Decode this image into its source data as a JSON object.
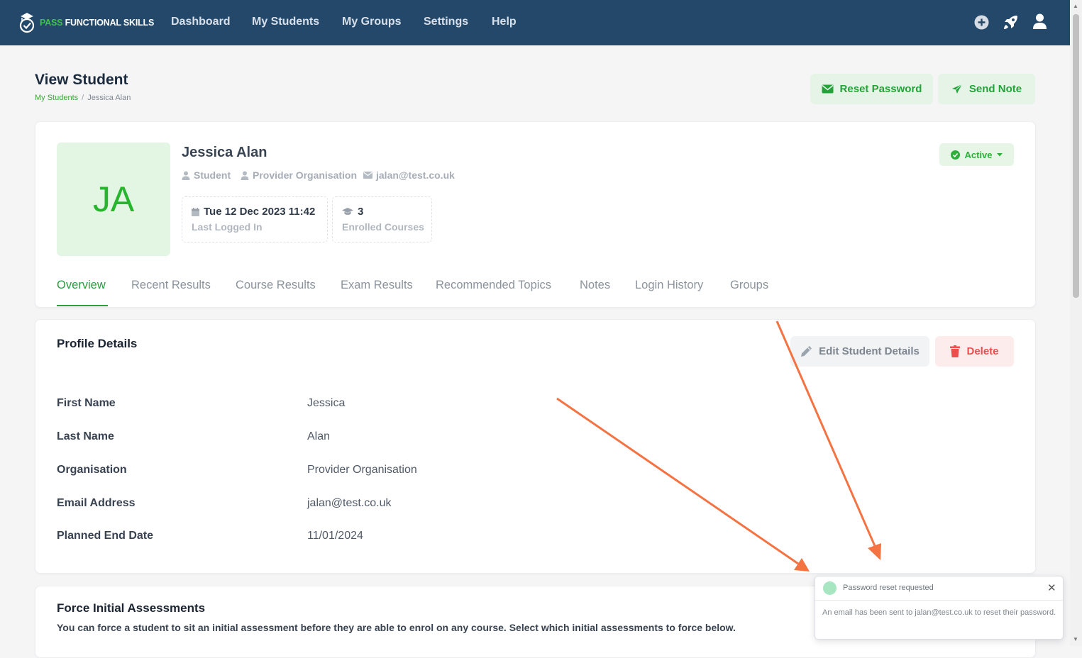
{
  "navbar": {
    "logo_pass": "PASS",
    "logo_rest": "FUNCTIONAL SKILLS",
    "items": [
      {
        "label": "Dashboard"
      },
      {
        "label": "My Students"
      },
      {
        "label": "My Groups"
      },
      {
        "label": "Settings"
      },
      {
        "label": "Help"
      }
    ],
    "icons": [
      "plus-circle-icon",
      "rocket-icon",
      "user-icon"
    ]
  },
  "page": {
    "title": "View Student",
    "breadcrumb": {
      "parent": "My Students",
      "separator": "/",
      "current": "Jessica Alan"
    },
    "reset_password_label": "Reset Password",
    "send_note_label": "Send Note"
  },
  "student": {
    "initials": "JA",
    "name": "Jessica Alan",
    "role": "Student",
    "organisation": "Provider Organisation",
    "email": "jalan@test.co.uk",
    "last_login_value": "Tue 12 Dec 2023 11:42",
    "last_login_label": "Last Logged In",
    "enrolled_value": "3",
    "enrolled_label": "Enrolled Courses",
    "status": "Active"
  },
  "tabs": [
    {
      "label": "Overview",
      "active": true
    },
    {
      "label": "Recent Results"
    },
    {
      "label": "Course Results"
    },
    {
      "label": "Exam Results"
    },
    {
      "label": "Recommended Topics"
    },
    {
      "label": "Notes"
    },
    {
      "label": "Login History"
    },
    {
      "label": "Groups"
    }
  ],
  "profile": {
    "title": "Profile Details",
    "edit_label": "Edit Student Details",
    "delete_label": "Delete",
    "fields": [
      {
        "label": "First Name",
        "value": "Jessica"
      },
      {
        "label": "Last Name",
        "value": "Alan"
      },
      {
        "label": "Organisation",
        "value": "Provider Organisation"
      },
      {
        "label": "Email Address",
        "value": "jalan@test.co.uk"
      },
      {
        "label": "Planned End Date",
        "value": "11/01/2024"
      }
    ]
  },
  "force_assessments": {
    "title": "Force Initial Assessments",
    "description": "You can force a student to sit an initial assessment before they are able to enrol on any course. Select which initial assessments to force below."
  },
  "toast": {
    "title": "Password reset requested",
    "body": "An email has been sent to jalan@test.co.uk to reset their password."
  },
  "colors": {
    "navbar": "#244869",
    "accent_green": "#2aa33f",
    "delete_red": "#ef4c4c",
    "annotation_arrow": "#f47342"
  }
}
